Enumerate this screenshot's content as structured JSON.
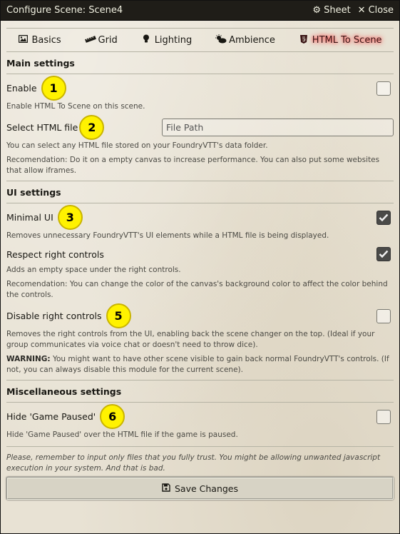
{
  "window": {
    "title": "Configure Scene: Scene4",
    "sheet_label": "Sheet",
    "close_label": "Close"
  },
  "tabs": [
    {
      "label": "Basics",
      "icon": "image-icon"
    },
    {
      "label": "Grid",
      "icon": "ruler-icon"
    },
    {
      "label": "Lighting",
      "icon": "lightbulb-icon"
    },
    {
      "label": "Ambience",
      "icon": "cloud-sun-icon"
    },
    {
      "label": "HTML To Scene",
      "icon": "html5-icon",
      "active": true
    }
  ],
  "main": {
    "heading": "Main settings",
    "enable": {
      "label": "Enable",
      "hint": "Enable HTML To Scene on this scene.",
      "checked": false,
      "badge": "1"
    },
    "select_file": {
      "label": "Select HTML file",
      "placeholder": "File Path",
      "badge": "2",
      "hint1": "You can select any HTML file stored on your FoundryVTT's data folder.",
      "hint2": "Recomendation: Do it on a empty canvas to increase performance. You can also put some websites that allow iframes."
    }
  },
  "ui": {
    "heading": "UI settings",
    "minimal": {
      "label": "Minimal UI",
      "badge": "3",
      "checked": true,
      "hint": "Removes unnecessary FoundryVTT's UI elements while a HTML file is being displayed."
    },
    "respect": {
      "label": "Respect right controls",
      "checked": true,
      "hint1": "Adds an empty space under the right controls.",
      "hint2": "Recomendation: You can change the color of the canvas's background color to affect the color behind the controls."
    },
    "disable": {
      "label": "Disable right controls",
      "badge": "5",
      "checked": false,
      "hint1": "Removes the right controls from the UI, enabling back the scene changer on the top. (Ideal if your group communicates via voice chat or doesn't need to throw dice).",
      "warning_label": "WARNING:",
      "warning_text": " You might want to have other scene visible to gain back normal FoundryVTT's controls. (If not, you can always disable this module for the current scene)."
    }
  },
  "misc": {
    "heading": "Miscellaneous settings",
    "hide_paused": {
      "label": "Hide 'Game Paused'",
      "badge": "6",
      "checked": false,
      "hint": "Hide 'Game Paused' over the HTML file if the game is paused."
    }
  },
  "footer": {
    "note": "Please, remember to input only files that you fully trust. You might be allowing unwanted javascript execution in your system. And that is bad.",
    "save_label": "Save Changes"
  }
}
